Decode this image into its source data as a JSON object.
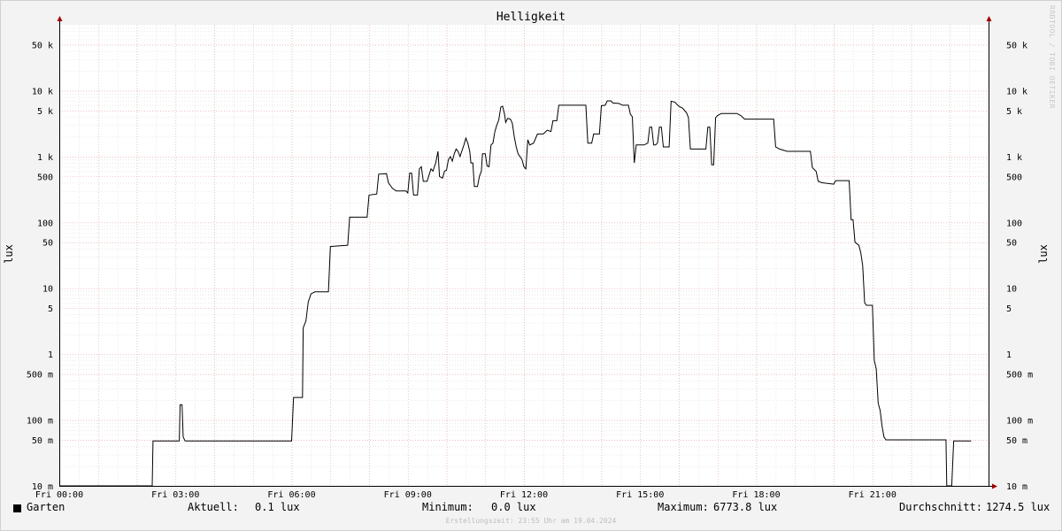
{
  "chart_data": {
    "type": "line",
    "title": "Helligkeit",
    "ylabel": "lux",
    "y_scale": "log",
    "ylim": [
      0.01,
      100000
    ],
    "xlim_hours": [
      0,
      24
    ],
    "grid": true,
    "x_ticks": [
      {
        "hour": 0,
        "label": "Fri 00:00"
      },
      {
        "hour": 3,
        "label": "Fri 03:00"
      },
      {
        "hour": 6,
        "label": "Fri 06:00"
      },
      {
        "hour": 9,
        "label": "Fri 09:00"
      },
      {
        "hour": 12,
        "label": "Fri 12:00"
      },
      {
        "hour": 15,
        "label": "Fri 15:00"
      },
      {
        "hour": 18,
        "label": "Fri 18:00"
      },
      {
        "hour": 21,
        "label": "Fri 21:00"
      }
    ],
    "y_ticks": [
      {
        "value": 0.01,
        "label": "10 m"
      },
      {
        "value": 0.05,
        "label": "50 m"
      },
      {
        "value": 0.1,
        "label": "100 m"
      },
      {
        "value": 0.5,
        "label": "500 m"
      },
      {
        "value": 1,
        "label": "1"
      },
      {
        "value": 5,
        "label": "5"
      },
      {
        "value": 10,
        "label": "10"
      },
      {
        "value": 50,
        "label": "50"
      },
      {
        "value": 100,
        "label": "100"
      },
      {
        "value": 500,
        "label": "500"
      },
      {
        "value": 1000,
        "label": "1 k"
      },
      {
        "value": 5000,
        "label": "5 k"
      },
      {
        "value": 10000,
        "label": "10 k"
      },
      {
        "value": 50000,
        "label": "50 k"
      }
    ],
    "series": [
      {
        "name": "Garten",
        "color": "#000000",
        "points": [
          [
            0.0,
            0.0
          ],
          [
            2.4,
            0.0
          ],
          [
            2.42,
            0.048
          ],
          [
            3.1,
            0.048
          ],
          [
            3.12,
            0.17
          ],
          [
            3.17,
            0.17
          ],
          [
            3.2,
            0.055
          ],
          [
            3.25,
            0.048
          ],
          [
            4.5,
            0.048
          ],
          [
            6.0,
            0.048
          ],
          [
            6.05,
            0.22
          ],
          [
            6.28,
            0.22
          ],
          [
            6.3,
            2.5
          ],
          [
            6.37,
            3.2
          ],
          [
            6.43,
            6.2
          ],
          [
            6.5,
            8.2
          ],
          [
            6.6,
            8.8
          ],
          [
            6.95,
            8.8
          ],
          [
            7.0,
            43
          ],
          [
            7.45,
            45
          ],
          [
            7.5,
            120
          ],
          [
            7.95,
            120
          ],
          [
            8.0,
            260
          ],
          [
            8.2,
            270
          ],
          [
            8.25,
            540
          ],
          [
            8.45,
            550
          ],
          [
            8.5,
            400
          ],
          [
            8.6,
            330
          ],
          [
            8.7,
            300
          ],
          [
            8.95,
            300
          ],
          [
            9.0,
            280
          ],
          [
            9.05,
            560
          ],
          [
            9.1,
            560
          ],
          [
            9.15,
            260
          ],
          [
            9.25,
            260
          ],
          [
            9.3,
            650
          ],
          [
            9.35,
            700
          ],
          [
            9.4,
            420
          ],
          [
            9.5,
            420
          ],
          [
            9.6,
            650
          ],
          [
            9.65,
            600
          ],
          [
            9.72,
            800
          ],
          [
            9.78,
            1200
          ],
          [
            9.82,
            500
          ],
          [
            9.9,
            470
          ],
          [
            9.95,
            600
          ],
          [
            10.0,
            620
          ],
          [
            10.05,
            900
          ],
          [
            10.1,
            1000
          ],
          [
            10.15,
            850
          ],
          [
            10.2,
            1100
          ],
          [
            10.25,
            1300
          ],
          [
            10.3,
            1200
          ],
          [
            10.35,
            1000
          ],
          [
            10.45,
            1500
          ],
          [
            10.5,
            1900
          ],
          [
            10.55,
            1600
          ],
          [
            10.6,
            1200
          ],
          [
            10.63,
            800
          ],
          [
            10.68,
            800
          ],
          [
            10.72,
            350
          ],
          [
            10.8,
            350
          ],
          [
            10.85,
            500
          ],
          [
            10.9,
            600
          ],
          [
            10.93,
            1100
          ],
          [
            11.0,
            1100
          ],
          [
            11.05,
            720
          ],
          [
            11.1,
            700
          ],
          [
            11.15,
            1500
          ],
          [
            11.2,
            1600
          ],
          [
            11.25,
            2400
          ],
          [
            11.3,
            3000
          ],
          [
            11.35,
            3600
          ],
          [
            11.4,
            5600
          ],
          [
            11.45,
            5800
          ],
          [
            11.5,
            4400
          ],
          [
            11.53,
            3300
          ],
          [
            11.58,
            3800
          ],
          [
            11.65,
            3700
          ],
          [
            11.7,
            3200
          ],
          [
            11.75,
            2000
          ],
          [
            11.8,
            1400
          ],
          [
            11.85,
            1100
          ],
          [
            11.9,
            1000
          ],
          [
            11.95,
            900
          ],
          [
            12.0,
            700
          ],
          [
            12.05,
            650
          ],
          [
            12.1,
            1800
          ],
          [
            12.15,
            1500
          ],
          [
            12.25,
            1600
          ],
          [
            12.35,
            2200
          ],
          [
            12.5,
            2200
          ],
          [
            12.6,
            2500
          ],
          [
            12.7,
            2400
          ],
          [
            12.75,
            3500
          ],
          [
            12.85,
            3500
          ],
          [
            12.9,
            6000
          ],
          [
            13.6,
            6000
          ],
          [
            13.65,
            1600
          ],
          [
            13.75,
            1600
          ],
          [
            13.8,
            2200
          ],
          [
            13.95,
            2200
          ],
          [
            14.0,
            5900
          ],
          [
            14.1,
            6000
          ],
          [
            14.15,
            7000
          ],
          [
            14.25,
            7000
          ],
          [
            14.3,
            6500
          ],
          [
            14.45,
            6400
          ],
          [
            14.55,
            6000
          ],
          [
            14.7,
            6000
          ],
          [
            14.75,
            4400
          ],
          [
            14.8,
            4000
          ],
          [
            14.85,
            800
          ],
          [
            14.9,
            1500
          ],
          [
            15.1,
            1500
          ],
          [
            15.2,
            1600
          ],
          [
            15.25,
            2800
          ],
          [
            15.3,
            2800
          ],
          [
            15.35,
            1500
          ],
          [
            15.4,
            1500
          ],
          [
            15.45,
            1600
          ],
          [
            15.5,
            2800
          ],
          [
            15.55,
            2800
          ],
          [
            15.6,
            1400
          ],
          [
            15.75,
            1400
          ],
          [
            15.8,
            6900
          ],
          [
            15.9,
            6700
          ],
          [
            15.95,
            6200
          ],
          [
            16.0,
            5800
          ],
          [
            16.1,
            5400
          ],
          [
            16.2,
            4600
          ],
          [
            16.25,
            3900
          ],
          [
            16.3,
            1300
          ],
          [
            16.5,
            1300
          ],
          [
            16.7,
            1300
          ],
          [
            16.75,
            2800
          ],
          [
            16.8,
            2800
          ],
          [
            16.85,
            750
          ],
          [
            16.9,
            750
          ],
          [
            16.95,
            3900
          ],
          [
            17.0,
            4200
          ],
          [
            17.1,
            4500
          ],
          [
            17.5,
            4500
          ],
          [
            17.6,
            4200
          ],
          [
            17.7,
            3700
          ],
          [
            18.0,
            3700
          ],
          [
            18.45,
            3700
          ],
          [
            18.5,
            1400
          ],
          [
            18.6,
            1300
          ],
          [
            18.8,
            1200
          ],
          [
            19.1,
            1200
          ],
          [
            19.4,
            1200
          ],
          [
            19.45,
            680
          ],
          [
            19.55,
            590
          ],
          [
            19.6,
            420
          ],
          [
            19.7,
            400
          ],
          [
            20.0,
            380
          ],
          [
            20.05,
            430
          ],
          [
            20.2,
            430
          ],
          [
            20.4,
            430
          ],
          [
            20.45,
            110
          ],
          [
            20.5,
            110
          ],
          [
            20.55,
            50
          ],
          [
            20.65,
            45
          ],
          [
            20.7,
            35
          ],
          [
            20.75,
            22
          ],
          [
            20.8,
            6
          ],
          [
            20.85,
            5.5
          ],
          [
            21.0,
            5.5
          ],
          [
            21.05,
            0.8
          ],
          [
            21.1,
            0.6
          ],
          [
            21.15,
            0.18
          ],
          [
            21.2,
            0.14
          ],
          [
            21.25,
            0.08
          ],
          [
            21.3,
            0.055
          ],
          [
            21.35,
            0.05
          ],
          [
            22.0,
            0.05
          ],
          [
            22.9,
            0.05
          ],
          [
            22.92,
            0.0
          ],
          [
            23.05,
            0.0
          ],
          [
            23.1,
            0.048
          ],
          [
            23.55,
            0.048
          ]
        ]
      }
    ],
    "legend": {
      "placement": "bottom"
    }
  },
  "legend_row": {
    "series_name": "Garten",
    "current_label": "Aktuell:",
    "current_value": "0.1 lux",
    "minimum_label": "Minimum:",
    "minimum_value": "0.0 lux",
    "maximum_label": "Maximum:",
    "maximum_value": "6773.8 lux",
    "average_label": "Durchschnitt:",
    "average_value": "1274.5 lux"
  },
  "footer": {
    "created": "Erstellungszeit: 23:55 Uhr am 19.04.2024"
  },
  "watermark": "RRDTOOL / TOBI OETIKER",
  "colors": {
    "background": "#f3f3f3",
    "canvas": "#ffffff",
    "major_grid": "#e8a0a0",
    "minor_grid": "#d6d6d6",
    "axis_arrow": "#a00000",
    "line": "#000000"
  }
}
